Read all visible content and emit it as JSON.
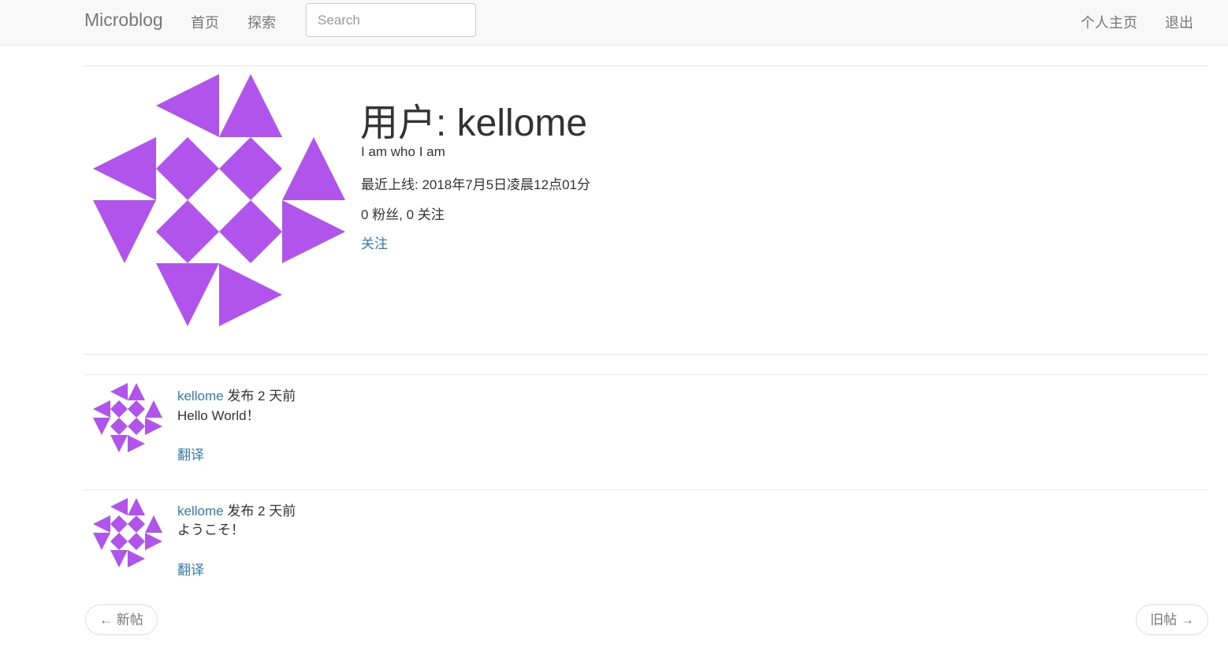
{
  "navbar": {
    "brand": "Microblog",
    "links": [
      "首页",
      "探索"
    ],
    "search_placeholder": "Search",
    "right_links": [
      "个人主页",
      "退出"
    ]
  },
  "profile": {
    "title": "用户: kellome",
    "about": "I am who I am",
    "last_seen": "最近上线: 2018年7月5日凌晨12点01分",
    "followers_following": "0 粉丝, 0 关注",
    "follow_link": "关注",
    "avatar_color": "#b154eb"
  },
  "posts": [
    {
      "author": "kellome",
      "meta": " 发布 2 天前",
      "body": "Hello World！",
      "translate": "翻译"
    },
    {
      "author": "kellome",
      "meta": " 发布 2 天前",
      "body": "ようこそ！",
      "translate": "翻译"
    }
  ],
  "pager": {
    "newer": "← 新帖",
    "older": "旧帖 →"
  }
}
